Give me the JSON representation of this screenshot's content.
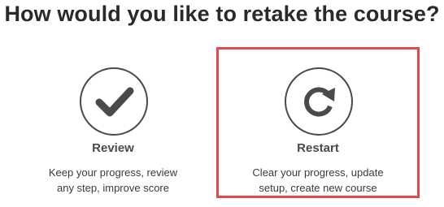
{
  "heading": "How would you like to retake the course?",
  "options": [
    {
      "id": "review",
      "title": "Review",
      "description_lines": [
        "Keep your progress, review",
        "any step, improve score"
      ],
      "icon": "checkmark-icon",
      "selected": false
    },
    {
      "id": "restart",
      "title": "Restart",
      "description_lines": [
        "Clear your progress, update",
        "setup, create new course"
      ],
      "icon": "refresh-icon",
      "selected": true
    }
  ],
  "colors": {
    "text": "#2a2a2a",
    "icon": "#4a4a4a",
    "highlight_border": "#e24b4b"
  }
}
